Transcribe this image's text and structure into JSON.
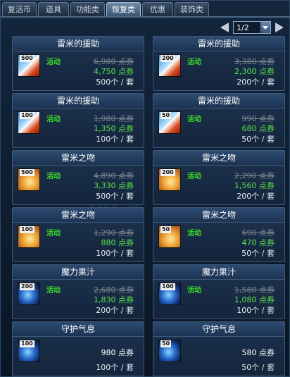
{
  "tabs": [
    {
      "label": "复活币",
      "active": false
    },
    {
      "label": "道具",
      "active": false
    },
    {
      "label": "功能类",
      "active": false
    },
    {
      "label": "恢复类",
      "active": true
    },
    {
      "label": "优惠",
      "active": false
    },
    {
      "label": "装饰类",
      "active": false
    }
  ],
  "pager": {
    "page": "1/2"
  },
  "colors": {
    "accent_green": "#5ae34a",
    "badge_green": "#3cdc28",
    "strike_gray": "#7d8793"
  },
  "items": [
    {
      "name": "雷米的援助",
      "icon": "blue-red",
      "count": "500",
      "badge": "活动",
      "old_price": "6,980 点券",
      "price": "4,750 点券",
      "qty": "500个 / 套"
    },
    {
      "name": "雷米的援助",
      "icon": "blue-red",
      "count": "200",
      "badge": "活动",
      "old_price": "3,380 点券",
      "price": "2,300 点券",
      "qty": "200个 / 套"
    },
    {
      "name": "雷米的援助",
      "icon": "blue-red",
      "count": "100",
      "badge": "活动",
      "old_price": "1,980 点券",
      "price": "1,350 点券",
      "qty": "100个 / 套"
    },
    {
      "name": "雷米的援助",
      "icon": "blue-red",
      "count": "50",
      "badge": "活动",
      "old_price": "990 点券",
      "price": "680 点券",
      "qty": "50个 / 套"
    },
    {
      "name": "雷米之吻",
      "icon": "orange",
      "count": "500",
      "badge": "活动",
      "old_price": "4,890 点券",
      "price": "3,330 点券",
      "qty": "500个 / 套"
    },
    {
      "name": "雷米之吻",
      "icon": "orange",
      "count": "200",
      "badge": "活动",
      "old_price": "2,290 点券",
      "price": "1,560 点券",
      "qty": "200个 / 套"
    },
    {
      "name": "雷米之吻",
      "icon": "orange",
      "count": "100",
      "badge": "活动",
      "old_price": "1,290 点券",
      "price": "880 点券",
      "qty": "100个 / 套"
    },
    {
      "name": "雷米之吻",
      "icon": "orange",
      "count": "50",
      "badge": "活动",
      "old_price": "690 点券",
      "price": "470 点券",
      "qty": "50个 / 套"
    },
    {
      "name": "魔力果汁",
      "icon": "orb",
      "count": "200",
      "badge": "活动",
      "old_price": "2,680 点券",
      "price": "1,830 点券",
      "qty": "200个 / 套"
    },
    {
      "name": "魔力果汁",
      "icon": "orb",
      "count": "100",
      "badge": "活动",
      "old_price": "1,580 点券",
      "price": "1,080 点券",
      "qty": "100个 / 套"
    },
    {
      "name": "守护气息",
      "icon": "orb",
      "count": "100",
      "badge": "",
      "old_price": "",
      "price": "980 点券",
      "qty": "100个 / 套"
    },
    {
      "name": "守护气息",
      "icon": "orb",
      "count": "50",
      "badge": "",
      "old_price": "",
      "price": "580 点券",
      "qty": "50个 / 套"
    }
  ]
}
